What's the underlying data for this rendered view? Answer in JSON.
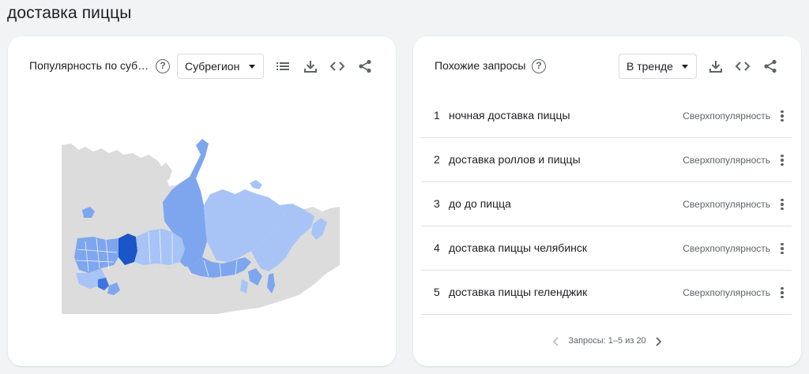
{
  "page": {
    "title": "доставка пиццы"
  },
  "left_card": {
    "title": "Популярность по суб…",
    "help_icon": "help-circle-icon",
    "resolution_select": {
      "selected": "Субрегион"
    },
    "tools": [
      "list-icon",
      "download-icon",
      "embed-code-icon",
      "share-icon"
    ],
    "map": {
      "colors": {
        "land": "#dcdcdc",
        "light": "#a8c4f7",
        "medium": "#7ea6ef",
        "dark": "#3f73e0",
        "darkest": "#1a56c8"
      }
    }
  },
  "right_card": {
    "title": "Похожие запросы",
    "help_icon": "help-circle-icon",
    "sort_select": {
      "selected": "В тренде"
    },
    "tools": [
      "download-icon",
      "embed-code-icon",
      "share-icon"
    ],
    "queries": [
      {
        "rank": "1",
        "term": "ночная доставка пиццы",
        "value": "Сверхпопулярность"
      },
      {
        "rank": "2",
        "term": "доставка роллов и пиццы",
        "value": "Сверхпопулярность"
      },
      {
        "rank": "3",
        "term": "до до пицца",
        "value": "Сверхпопулярность"
      },
      {
        "rank": "4",
        "term": "доставка пиццы челябинск",
        "value": "Сверхпопулярность"
      },
      {
        "rank": "5",
        "term": "доставка пиццы геленджик",
        "value": "Сверхпопулярность"
      }
    ],
    "pagination": {
      "label": "Запросы: 1–5 из 20",
      "prev_icon": "chevron-left-icon",
      "next_icon": "chevron-right-icon"
    }
  }
}
